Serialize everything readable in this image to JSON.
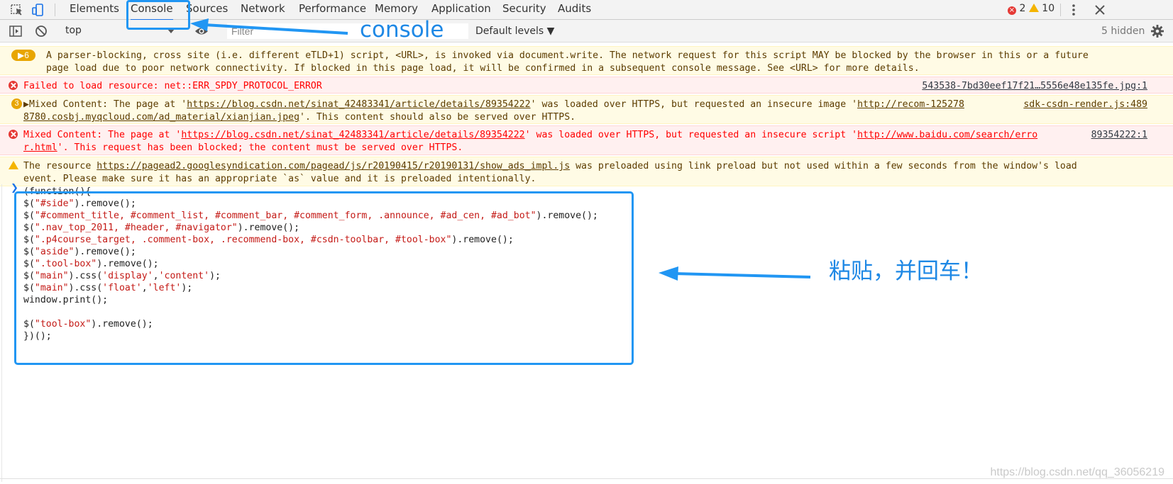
{
  "tabs": [
    {
      "label": "Elements"
    },
    {
      "label": "Console",
      "active": true
    },
    {
      "label": "Sources"
    },
    {
      "label": "Network"
    },
    {
      "label": "Performance"
    },
    {
      "label": "Memory"
    },
    {
      "label": "Application"
    },
    {
      "label": "Security"
    },
    {
      "label": "Audits"
    }
  ],
  "counts": {
    "errors": "2",
    "warnings": "10"
  },
  "toolbar": {
    "context": "top",
    "filter_placeholder": "Filter",
    "levels": "Default levels ▼",
    "hidden": "5 hidden"
  },
  "messages": {
    "m1": {
      "badge": "▶6",
      "line1": "A parser-blocking, cross site (i.e. different eTLD+1) script, <URL>, is invoked via document.write. The network request for this script MAY be blocked by the browser in this or a future",
      "line2": "page load due to poor network connectivity. If blocked in this page load, it will be confirmed in a subsequent console message. See <URL> for more details."
    },
    "m2": {
      "text": "Failed to load resource: net::ERR_SPDY_PROTOCOL_ERROR",
      "source": "543538-7bd30eef17f21…5556e48e135fe.jpg:1"
    },
    "m3": {
      "badge": "3",
      "p1": "▶Mixed Content: The page at '",
      "link1": "https://blog.csdn.net/sinat_42483341/article/details/89354222",
      "p2": "' was loaded over HTTPS, but requested an insecure image '",
      "link2": "http://recom-125278",
      "link3": "8780.cosbj.myqcloud.com/ad_material/xianjian.jpeg",
      "p3": "'. This content should also be served over HTTPS.",
      "source": "sdk-csdn-render.js:489"
    },
    "m4": {
      "p1": "Mixed Content: The page at '",
      "link1": "https://blog.csdn.net/sinat_42483341/article/details/89354222",
      "p2": "' was loaded over HTTPS, but requested an insecure script '",
      "link2": "http://www.baidu.com/search/erro",
      "link3": "r.html",
      "p3": "'. This request has been blocked; the content must be served over HTTPS.",
      "source": "89354222:1"
    },
    "m5": {
      "p1": "The resource ",
      "link1": "https://pagead2.googlesyndication.com/pagead/js/r20190415/r20190131/show_ads_impl.js",
      "p2": " was preloaded using link preload but not used within a few seconds from the window's load",
      "line2": "event. Please make sure it has an appropriate `as` value and it is preloaded intentionally."
    }
  },
  "code": {
    "l0": "(function(){",
    "l1a": "$(",
    "l1s": "\"#side\"",
    "l1b": ").remove();",
    "l2a": "$(",
    "l2s": "\"#comment_title, #comment_list, #comment_bar, #comment_form, .announce, #ad_cen, #ad_bot\"",
    "l2b": ").remove();",
    "l3a": "$(",
    "l3s": "\".nav_top_2011, #header, #navigator\"",
    "l3b": ").remove();",
    "l4a": "$(",
    "l4s": "\".p4course_target, .comment-box, .recommend-box, #csdn-toolbar, #tool-box\"",
    "l4b": ").remove();",
    "l5a": "$(",
    "l5s": "\"aside\"",
    "l5b": ").remove();",
    "l6a": "$(",
    "l6s": "\".tool-box\"",
    "l6b": ").remove();",
    "l7a": "$(",
    "l7s": "\"main\"",
    "l7b": ").css(",
    "l7s2": "'display'",
    "l7c": ",",
    "l7s3": "'content'",
    "l7d": ");",
    "l8a": "$(",
    "l8s": "\"main\"",
    "l8b": ").css(",
    "l8s2": "'float'",
    "l8c": ",",
    "l8s3": "'left'",
    "l8d": ");",
    "l9": "window.print();",
    "l11a": "$(",
    "l11s": "\"tool-box\"",
    "l11b": ").remove();",
    "l12": "})();"
  },
  "annotations": {
    "console": "console",
    "paste": "粘贴，并回车！"
  },
  "watermark": "https://blog.csdn.net/qq_36056219",
  "colors": {
    "accent": "#2196f3",
    "error": "#ff0000",
    "warning_bg": "#fffbe5"
  }
}
